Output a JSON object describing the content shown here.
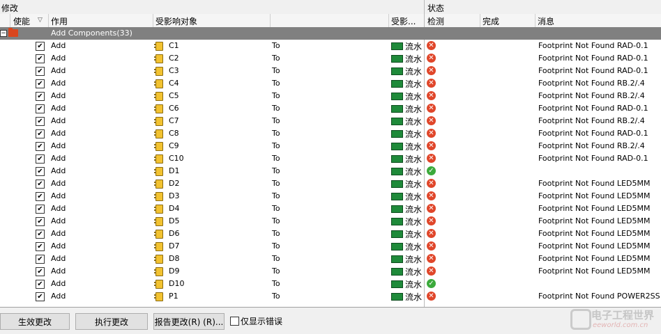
{
  "header": {
    "group_modify": "修改",
    "group_status": "状态",
    "col_enable": "使能",
    "col_action": "作用",
    "col_affected_object": "受影响对象",
    "col_affected_doc": "受影...",
    "col_check": "检测",
    "col_done": "完成",
    "col_message": "消息",
    "sort_glyph": "▽"
  },
  "group": {
    "label": "Add Components(33)",
    "expander": "−"
  },
  "rows": [
    {
      "enabled": true,
      "action": "Add",
      "object": "C1",
      "to": "To",
      "target": "流水",
      "check": "error",
      "message": "Footprint Not Found RAD-0.1"
    },
    {
      "enabled": true,
      "action": "Add",
      "object": "C2",
      "to": "To",
      "target": "流水",
      "check": "error",
      "message": "Footprint Not Found RAD-0.1"
    },
    {
      "enabled": true,
      "action": "Add",
      "object": "C3",
      "to": "To",
      "target": "流水",
      "check": "error",
      "message": "Footprint Not Found RAD-0.1"
    },
    {
      "enabled": true,
      "action": "Add",
      "object": "C4",
      "to": "To",
      "target": "流水",
      "check": "error",
      "message": "Footprint Not Found RB.2/.4"
    },
    {
      "enabled": true,
      "action": "Add",
      "object": "C5",
      "to": "To",
      "target": "流水",
      "check": "error",
      "message": "Footprint Not Found RB.2/.4"
    },
    {
      "enabled": true,
      "action": "Add",
      "object": "C6",
      "to": "To",
      "target": "流水",
      "check": "error",
      "message": "Footprint Not Found RAD-0.1"
    },
    {
      "enabled": true,
      "action": "Add",
      "object": "C7",
      "to": "To",
      "target": "流水",
      "check": "error",
      "message": "Footprint Not Found RB.2/.4"
    },
    {
      "enabled": true,
      "action": "Add",
      "object": "C8",
      "to": "To",
      "target": "流水",
      "check": "error",
      "message": "Footprint Not Found RAD-0.1"
    },
    {
      "enabled": true,
      "action": "Add",
      "object": "C9",
      "to": "To",
      "target": "流水",
      "check": "error",
      "message": "Footprint Not Found RB.2/.4"
    },
    {
      "enabled": true,
      "action": "Add",
      "object": "C10",
      "to": "To",
      "target": "流水",
      "check": "error",
      "message": "Footprint Not Found RAD-0.1"
    },
    {
      "enabled": true,
      "action": "Add",
      "object": "D1",
      "to": "To",
      "target": "流水",
      "check": "ok",
      "message": ""
    },
    {
      "enabled": true,
      "action": "Add",
      "object": "D2",
      "to": "To",
      "target": "流水",
      "check": "error",
      "message": "Footprint Not Found LED5MM"
    },
    {
      "enabled": true,
      "action": "Add",
      "object": "D3",
      "to": "To",
      "target": "流水",
      "check": "error",
      "message": "Footprint Not Found LED5MM"
    },
    {
      "enabled": true,
      "action": "Add",
      "object": "D4",
      "to": "To",
      "target": "流水",
      "check": "error",
      "message": "Footprint Not Found LED5MM"
    },
    {
      "enabled": true,
      "action": "Add",
      "object": "D5",
      "to": "To",
      "target": "流水",
      "check": "error",
      "message": "Footprint Not Found LED5MM"
    },
    {
      "enabled": true,
      "action": "Add",
      "object": "D6",
      "to": "To",
      "target": "流水",
      "check": "error",
      "message": "Footprint Not Found LED5MM"
    },
    {
      "enabled": true,
      "action": "Add",
      "object": "D7",
      "to": "To",
      "target": "流水",
      "check": "error",
      "message": "Footprint Not Found LED5MM"
    },
    {
      "enabled": true,
      "action": "Add",
      "object": "D8",
      "to": "To",
      "target": "流水",
      "check": "error",
      "message": "Footprint Not Found LED5MM"
    },
    {
      "enabled": true,
      "action": "Add",
      "object": "D9",
      "to": "To",
      "target": "流水",
      "check": "error",
      "message": "Footprint Not Found LED5MM"
    },
    {
      "enabled": true,
      "action": "Add",
      "object": "D10",
      "to": "To",
      "target": "流水",
      "check": "ok",
      "message": ""
    },
    {
      "enabled": true,
      "action": "Add",
      "object": "P1",
      "to": "To",
      "target": "流水",
      "check": "error",
      "message": "Footprint Not Found POWER2SS"
    }
  ],
  "footer": {
    "validate_button": "生效更改",
    "execute_button": "执行更改",
    "report_button": "报告更改(R) (R)...",
    "errors_only_label": "仅显示错误"
  },
  "watermark": {
    "title": "电子工程世界",
    "url": "eeworld.com.cn"
  },
  "glyphs": {
    "check_mark": "✔",
    "error_mark": "✕",
    "ok_mark": "✓"
  },
  "icons": {
    "component": "component-chip-icon",
    "target_doc": "pcb-document-icon",
    "folder": "folder-icon",
    "error": "error-circle-icon",
    "ok": "ok-circle-icon"
  },
  "colors": {
    "group_bg": "#808080",
    "error": "#e0462a",
    "ok": "#3caa3c",
    "folder": "#d9461e",
    "pcb": "#1f8a3a"
  }
}
